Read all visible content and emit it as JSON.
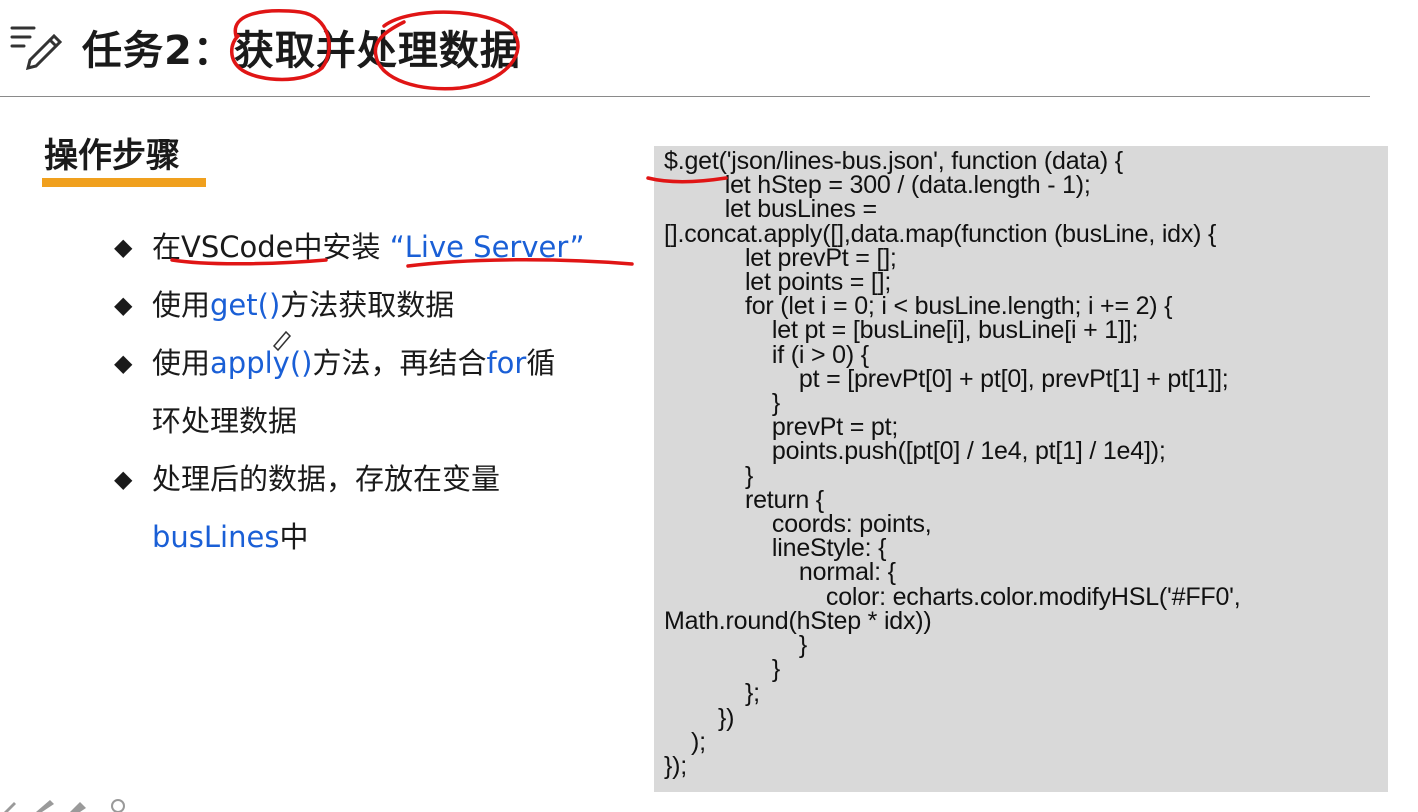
{
  "header": {
    "title": "任务2：获取并处理数据",
    "icon": "notes-pen-icon"
  },
  "section": {
    "title": "操作步骤",
    "accent_color": "#f0a01e"
  },
  "bullets": [
    {
      "pre": "在VSCode中安装 ",
      "hl": "“Live Server”",
      "post": ""
    },
    {
      "pre": "使用",
      "hl": "get()",
      "post": "方法获取数据"
    },
    {
      "pre": "使用",
      "hl": "apply()",
      "post": "方法，再结合",
      "hl2": "for",
      "post2": "循",
      "cont": "环处理数据"
    },
    {
      "pre": "处理后的数据，存放在变量",
      "hl": "",
      "post": "",
      "cont_hl": "busLines",
      "cont_post": "中"
    }
  ],
  "code": "$.get('json/lines-bus.json', function (data) {\n         let hStep = 300 / (data.length - 1);\n         let busLines =\n[].concat.apply([],data.map(function (busLine, idx) {\n            let prevPt = [];\n            let points = [];\n            for (let i = 0; i < busLine.length; i += 2) {\n                let pt = [busLine[i], busLine[i + 1]];\n                if (i > 0) {\n                    pt = [prevPt[0] + pt[0], prevPt[1] + pt[1]];\n                }\n                prevPt = pt;\n                points.push([pt[0] / 1e4, pt[1] / 1e4]);\n            }\n            return {\n                coords: points,\n                lineStyle: {\n                    normal: {\n                        color: echarts.color.modifyHSL('#FF0',\nMath.round(hStep * idx))\n                    }\n                }\n            };\n        })\n    );\n});",
  "colors": {
    "highlight_text": "#1a5fd6",
    "annotation_ink": "#e01515",
    "code_background": "#d9d9d9"
  }
}
